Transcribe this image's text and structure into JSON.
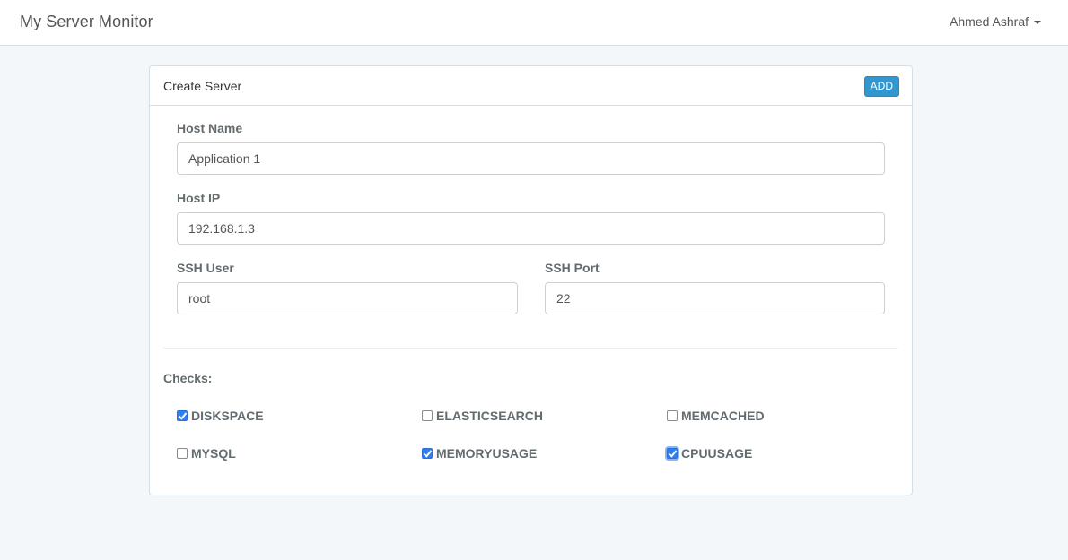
{
  "navbar": {
    "brand": "My Server Monitor",
    "user": "Ahmed Ashraf"
  },
  "panel": {
    "title": "Create Server",
    "add_label": "ADD"
  },
  "form": {
    "host_name": {
      "label": "Host Name",
      "value": "Application 1"
    },
    "host_ip": {
      "label": "Host IP",
      "value": "192.168.1.3"
    },
    "ssh_user": {
      "label": "SSH User",
      "value": "root"
    },
    "ssh_port": {
      "label": "SSH Port",
      "value": "22"
    }
  },
  "checks": {
    "label": "Checks:",
    "items": [
      {
        "label": "DISKSPACE",
        "checked": true
      },
      {
        "label": "ELASTICSEARCH",
        "checked": false
      },
      {
        "label": "MEMCACHED",
        "checked": false
      },
      {
        "label": "MYSQL",
        "checked": false
      },
      {
        "label": "MEMORYUSAGE",
        "checked": true
      },
      {
        "label": "CPUUSAGE",
        "checked": true,
        "focused": true
      }
    ]
  },
  "colors": {
    "accent": "#3097d1",
    "checkbox_checked": "#2f7ff0",
    "background": "#f4f7fa"
  }
}
